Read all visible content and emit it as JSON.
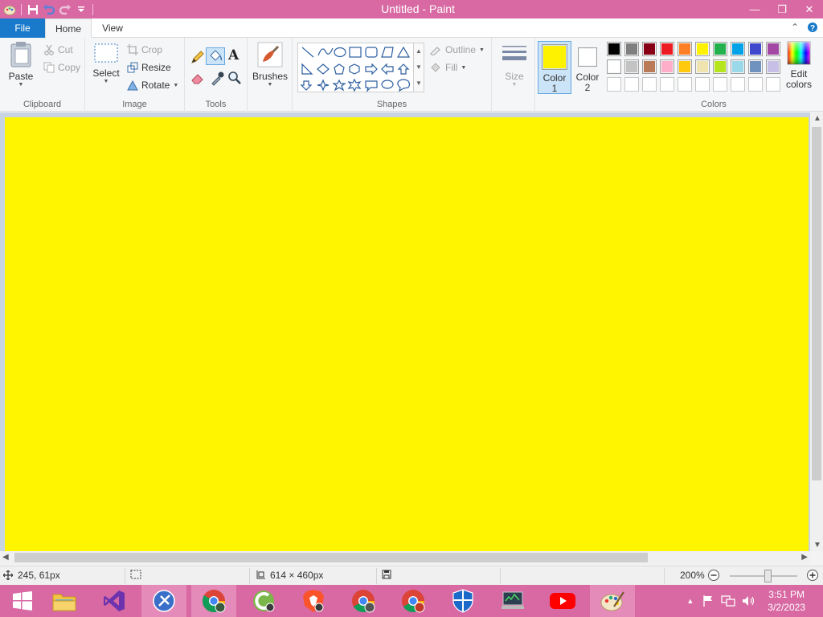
{
  "window": {
    "title": "Untitled - Paint",
    "minimize": "—",
    "restore": "❐",
    "close": "✕"
  },
  "tabs": {
    "file": "File",
    "home": "Home",
    "view": "View"
  },
  "clipboard": {
    "paste": "Paste",
    "cut": "Cut",
    "copy": "Copy",
    "label": "Clipboard"
  },
  "image": {
    "select": "Select",
    "crop": "Crop",
    "resize": "Resize",
    "rotate": "Rotate",
    "label": "Image"
  },
  "tools": {
    "label": "Tools",
    "text_glyph": "A"
  },
  "brushes": {
    "label": "Brushes"
  },
  "shapes": {
    "outline": "Outline",
    "fill": "Fill",
    "label": "Shapes"
  },
  "size": {
    "label": "Size"
  },
  "color1": {
    "line1": "Color",
    "line2": "1",
    "value": "#fff200"
  },
  "color2": {
    "line1": "Color",
    "line2": "2",
    "value": "#ffffff"
  },
  "colors": {
    "label": "Colors",
    "edit_line1": "Edit",
    "edit_line2": "colors",
    "row1": [
      "#000000",
      "#7f7f7f",
      "#880015",
      "#ed1c24",
      "#ff7f27",
      "#fff200",
      "#22b14c",
      "#00a2e8",
      "#3f48cc",
      "#a349a4"
    ],
    "row2": [
      "#ffffff",
      "#c3c3c3",
      "#b97a57",
      "#ffaec9",
      "#ffc90e",
      "#efe4b0",
      "#b5e61d",
      "#99d9ea",
      "#7092be",
      "#c8bfe7"
    ]
  },
  "canvas": {
    "color": "#fff500"
  },
  "status": {
    "cursor": "245, 61px",
    "size": "614 × 460px",
    "zoom": "200%"
  },
  "taskbar": {
    "time": "3:51 PM",
    "date": "3/2/2023"
  }
}
